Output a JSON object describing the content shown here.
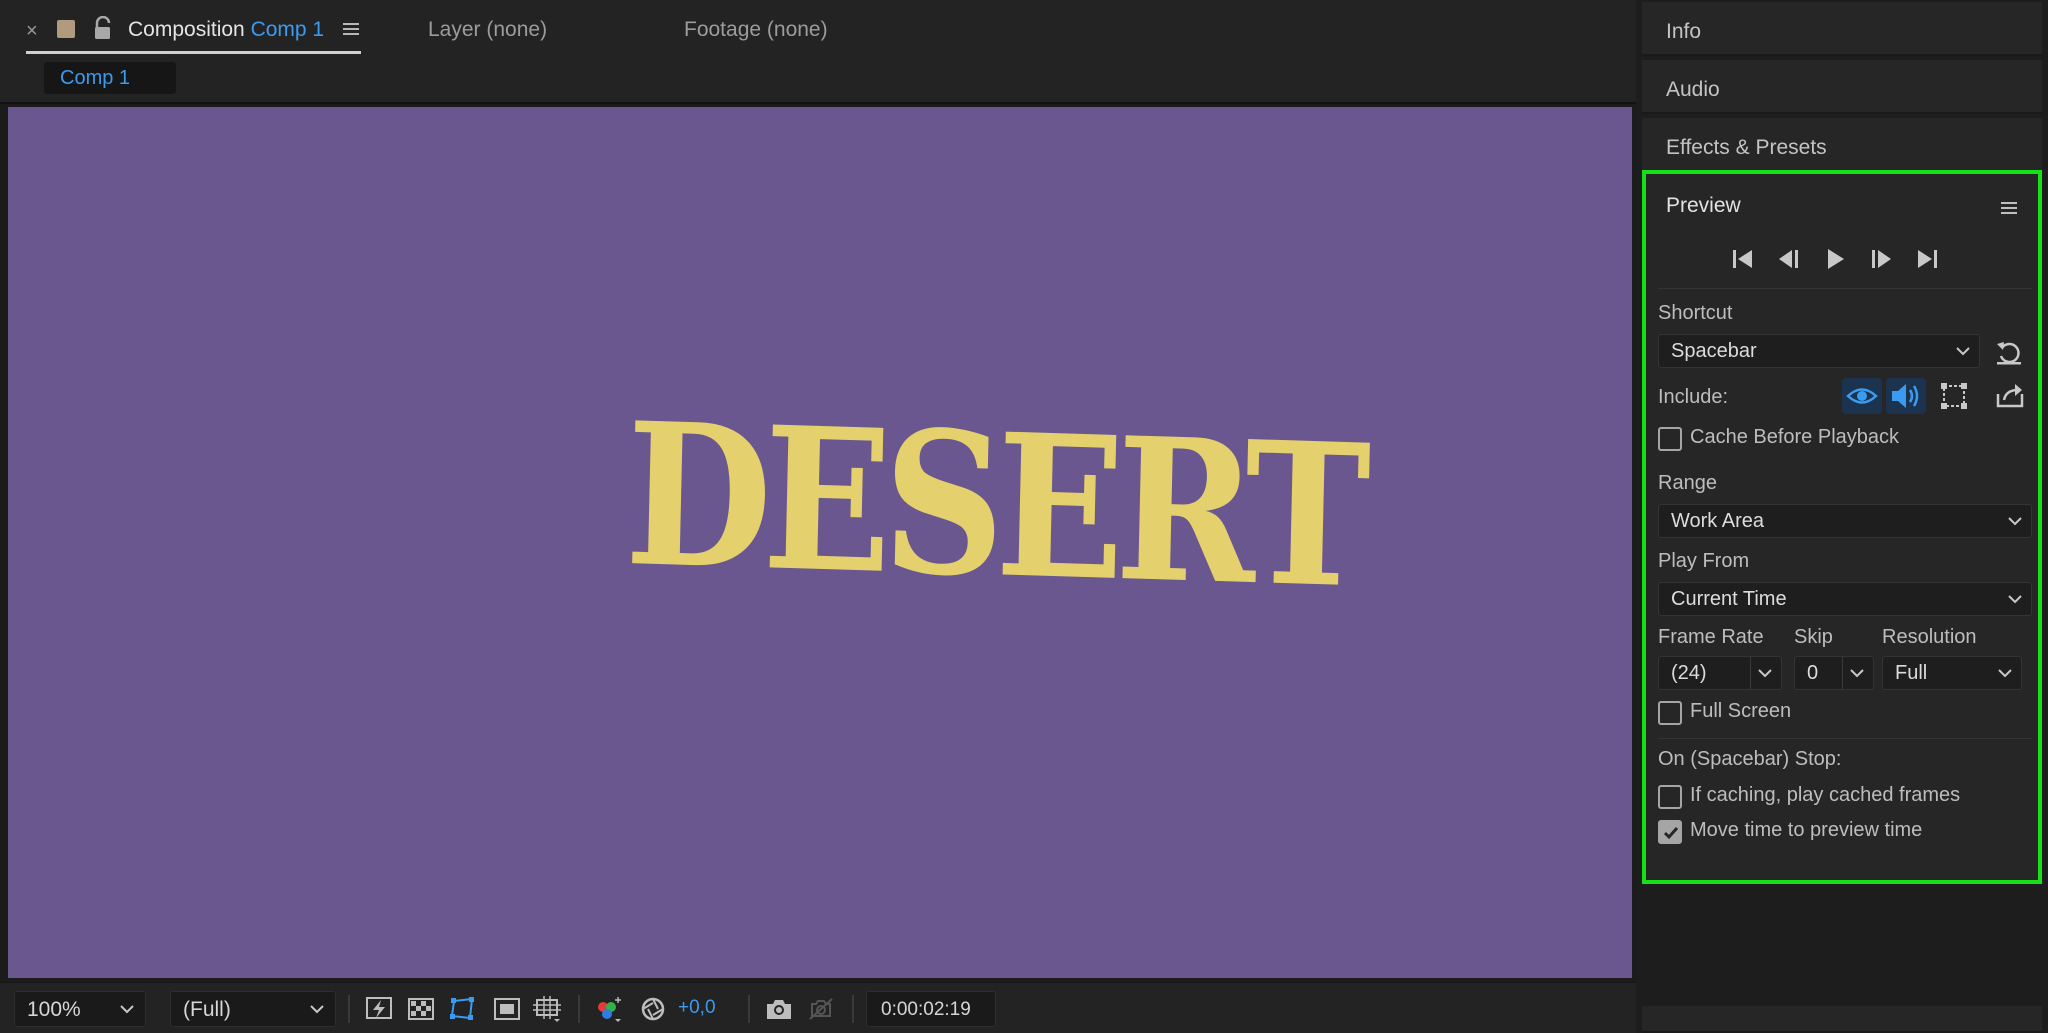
{
  "comp_tab": {
    "close": "×",
    "prefix": "Composition",
    "name": "Comp 1"
  },
  "other_tabs": {
    "layer": "Layer (none)",
    "footage": "Footage (none)"
  },
  "comp_chip": "Comp 1",
  "canvas": {
    "text": "DESERT",
    "background": "#6a578f",
    "text_color": "#e4d06c"
  },
  "viewer_toolbar": {
    "zoom": "100%",
    "resolution": "(Full)",
    "exposure": "+0,0",
    "timecode": "0:00:02:19"
  },
  "right_panels": {
    "info": "Info",
    "audio": "Audio",
    "effects": "Effects & Presets"
  },
  "preview": {
    "title": "Preview",
    "shortcut_label": "Shortcut",
    "shortcut_value": "Spacebar",
    "include_label": "Include:",
    "cache_before_playback": "Cache Before Playback",
    "range_label": "Range",
    "range_value": "Work Area",
    "play_from_label": "Play From",
    "play_from_value": "Current Time",
    "frame_rate_label": "Frame Rate",
    "frame_rate_value": "(24)",
    "skip_label": "Skip",
    "skip_value": "0",
    "resolution_label": "Resolution",
    "resolution_value": "Full",
    "full_screen": "Full Screen",
    "on_stop_label": "On (Spacebar) Stop:",
    "if_caching": "If caching, play cached frames",
    "move_time": "Move time to preview time",
    "checks": {
      "cache_before_playback": false,
      "full_screen": false,
      "if_caching": false,
      "move_time": true
    }
  },
  "colors": {
    "accent": "#3a9bf0",
    "highlight_border": "#18e018"
  }
}
